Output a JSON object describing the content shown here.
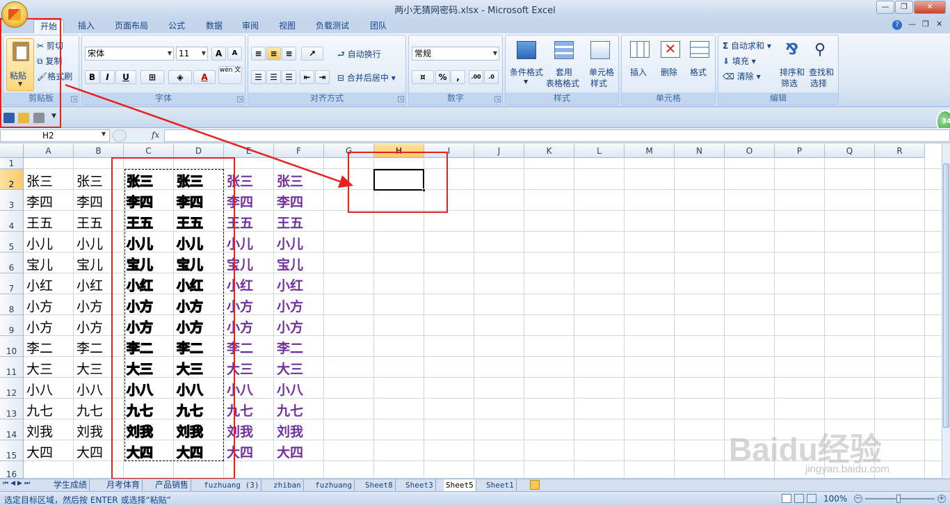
{
  "window": {
    "title": "两小无猜网密码.xlsx - Microsoft Excel"
  },
  "tabs": [
    "开始",
    "插入",
    "页面布局",
    "公式",
    "数据",
    "审阅",
    "视图",
    "负载测试",
    "团队"
  ],
  "ribbon": {
    "clipboard": {
      "label": "剪贴板",
      "paste": "粘贴",
      "cut": "剪切",
      "copy": "复制",
      "format_painter": "格式刷"
    },
    "font": {
      "label": "字体",
      "font_name": "宋体",
      "font_size": "11",
      "bold": "B",
      "italic": "I",
      "underline": "U",
      "grow": "A",
      "shrink": "A",
      "font_color": "A",
      "wen": "wén 文"
    },
    "alignment": {
      "label": "对齐方式",
      "wrap_text": "自动换行",
      "merge_center": "合并后居中"
    },
    "number": {
      "label": "数字",
      "format": "常规",
      "percent": "%",
      "comma": ",",
      "inc": ".00",
      "dec": ".0"
    },
    "styles": {
      "label": "样式",
      "conditional": "条件格式",
      "table_format_1": "套用",
      "table_format_2": "表格格式",
      "cell_styles_1": "单元格",
      "cell_styles_2": "样式"
    },
    "cells": {
      "label": "单元格",
      "insert": "插入",
      "delete": "删除",
      "format": "格式"
    },
    "editing": {
      "label": "编辑",
      "autosum": "自动求和",
      "fill": "填充",
      "clear": "清除",
      "sort_1": "排序和",
      "sort_2": "筛选",
      "find_1": "查找和",
      "find_2": "选择"
    }
  },
  "formula_bar": {
    "name_box": "H2",
    "fx": "fx",
    "formula": ""
  },
  "columns": [
    "A",
    "B",
    "C",
    "D",
    "E",
    "F",
    "G",
    "H",
    "I",
    "J",
    "K",
    "L",
    "M",
    "N",
    "O",
    "P",
    "Q",
    "R"
  ],
  "rows": [
    "1",
    "2",
    "3",
    "4",
    "5",
    "6",
    "7",
    "8",
    "9",
    "10",
    "11",
    "12",
    "13",
    "14",
    "15",
    "16"
  ],
  "cells": {
    "names": [
      "张三",
      "李四",
      "王五",
      "小儿",
      "宝儿",
      "小红",
      "小方",
      "小方",
      "李二",
      "大三",
      "小八",
      "九七",
      "刘我",
      "大四"
    ]
  },
  "sheet_tabs": [
    "学生成绩",
    "月考体育",
    "产品销售",
    "fuzhuang (3)",
    "zhiban",
    "fuzhuang",
    "Sheet8",
    "Sheet3",
    "Sheet5",
    "Sheet1"
  ],
  "active_sheet": "Sheet5",
  "status": {
    "message": "选定目标区域，然后按 ENTER 或选择“粘贴”",
    "zoom": "100%"
  },
  "badge": "34",
  "watermark": {
    "brand": "Baidu经验",
    "url": "jingyan.baidu.com"
  },
  "colors": {
    "accent_red": "#e8201b",
    "purple_text": "#7030a0",
    "selected_header": "#f9c96a"
  }
}
